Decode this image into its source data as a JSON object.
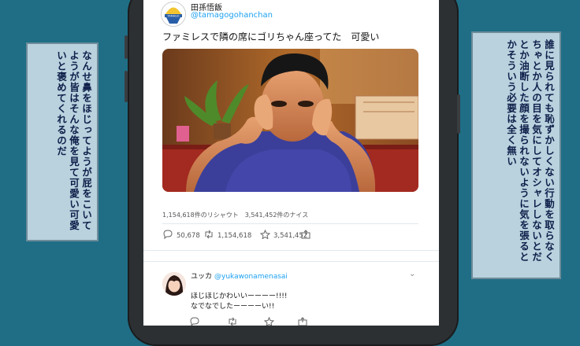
{
  "tweet": {
    "display_name": "田孫悟飯",
    "handle": "@tamagogohanchan",
    "text": "ファミレスで隣の席にゴリちゃん座ってた　可愛い",
    "stats": "1,154,618件のリシャウト　3,541,452件のナイス",
    "actions": {
      "reply_count": "50,678",
      "retweet_count": "1,154,618",
      "like_count": "3,541,452"
    }
  },
  "reply": {
    "display_name": "ユッカ",
    "handle": "@yukawonamenasai",
    "line1": "ほじほじかわいいーーーー!!!!",
    "line2": "なでなでしたーーーーい!!"
  },
  "captions": {
    "left": "なんせ鼻をほじってようが屁をこいてようが皆はそんな俺を見て可愛い可愛いと褒めてくれるのだ",
    "right": "誰に見られても恥ずかしくない行動を取らなくちゃとか人の目を気にしてオシャレしないとだとか油断した顔を撮られないように気を張るとかそういう必要は全く無い"
  },
  "colors": {
    "background": "#1f6e86",
    "accent": "#1da1f2",
    "caption_bg": "#b9d2de",
    "caption_text": "#0f1f4a"
  },
  "icons": [
    "avatar-egg-logo",
    "reply-icon",
    "retweet-icon",
    "like-icon",
    "share-icon",
    "chevron-down-icon"
  ]
}
